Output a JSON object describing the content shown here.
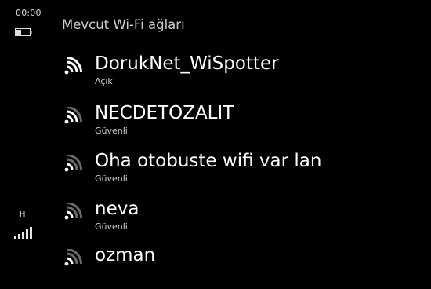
{
  "status_bar": {
    "time": "00:00",
    "network_type": "H",
    "battery_icon": "battery-icon",
    "signal_icon": "signal-bars-icon"
  },
  "page": {
    "title": "Mevcut Wi-Fi ağları"
  },
  "networks": [
    {
      "name": "DorukNet_WiSpotter",
      "status": "Açık",
      "icon": "wifi-icon"
    },
    {
      "name": "NECDETOZALIT",
      "status": "Güvenli",
      "icon": "wifi-icon"
    },
    {
      "name": "Oha otobuste wifi var lan",
      "status": "Güvenli",
      "icon": "wifi-icon"
    },
    {
      "name": "neva",
      "status": "Güvenli",
      "icon": "wifi-icon"
    },
    {
      "name": "ozman",
      "status": "",
      "icon": "wifi-icon"
    }
  ],
  "colors": {
    "background": "#000000",
    "text_primary": "#ffffff",
    "text_secondary": "#cfcfcf"
  }
}
